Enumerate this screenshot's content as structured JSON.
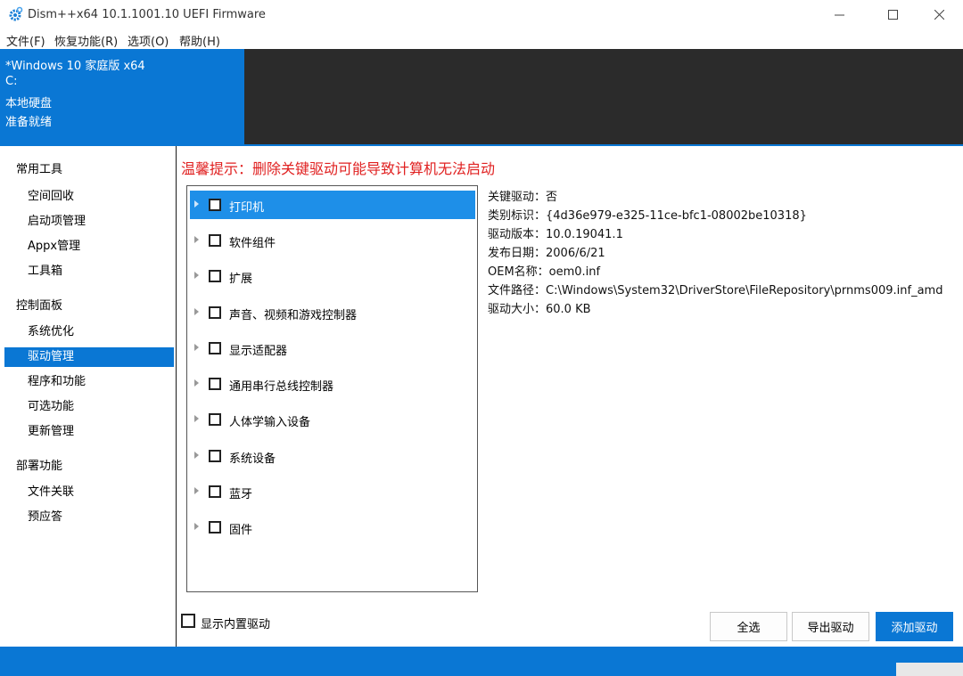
{
  "window": {
    "title": "Dism++x64 10.1.1001.10 UEFI Firmware",
    "controls": [
      "minimize",
      "maximize",
      "close"
    ]
  },
  "menu": [
    "文件(F)",
    "恢复功能(R)",
    "选项(O)",
    "帮助(H)"
  ],
  "system_info": {
    "os": "*Windows 10 家庭版 x64",
    "drive": "C:",
    "disk_type": "本地硬盘",
    "status": "准备就绪"
  },
  "sidebar": {
    "groups": [
      {
        "title": "常用工具",
        "items": [
          "空间回收",
          "启动项管理",
          "Appx管理",
          "工具箱"
        ]
      },
      {
        "title": "控制面板",
        "items": [
          "系统优化",
          "驱动管理",
          "程序和功能",
          "可选功能",
          "更新管理"
        ]
      },
      {
        "title": "部署功能",
        "items": [
          "文件关联",
          "预应答"
        ]
      }
    ],
    "active_item": "驱动管理"
  },
  "warning": "温馨提示：删除关键驱动可能导致计算机无法启动",
  "driver_categories": [
    {
      "label": "打印机",
      "selected": true,
      "checked": false
    },
    {
      "label": "软件组件",
      "selected": false,
      "checked": false
    },
    {
      "label": "扩展",
      "selected": false,
      "checked": false
    },
    {
      "label": "声音、视频和游戏控制器",
      "selected": false,
      "checked": false
    },
    {
      "label": "显示适配器",
      "selected": false,
      "checked": false
    },
    {
      "label": "通用串行总线控制器",
      "selected": false,
      "checked": false
    },
    {
      "label": "人体学输入设备",
      "selected": false,
      "checked": false
    },
    {
      "label": "系统设备",
      "selected": false,
      "checked": false
    },
    {
      "label": "蓝牙",
      "selected": false,
      "checked": false
    },
    {
      "label": "固件",
      "selected": false,
      "checked": false
    }
  ],
  "details": [
    "关键驱动：否",
    "类别标识：{4d36e979-e325-11ce-bfc1-08002be10318}",
    "驱动版本：10.0.19041.1",
    "发布日期：2006/6/21",
    "OEM名称：oem0.inf",
    "文件路径：C:\\Windows\\System32\\DriverStore\\FileRepository\\prnms009.inf_amd",
    "驱动大小：60.0 KB"
  ],
  "show_builtin": {
    "label": "显示内置驱动",
    "checked": false
  },
  "buttons": {
    "select_all": "全选",
    "export": "导出驱动",
    "add": "添加驱动"
  },
  "colors": {
    "accent": "#0a77d4",
    "warning": "#e02020",
    "selection": "#1e8fe8",
    "dark_panel": "#2b2b2b"
  }
}
